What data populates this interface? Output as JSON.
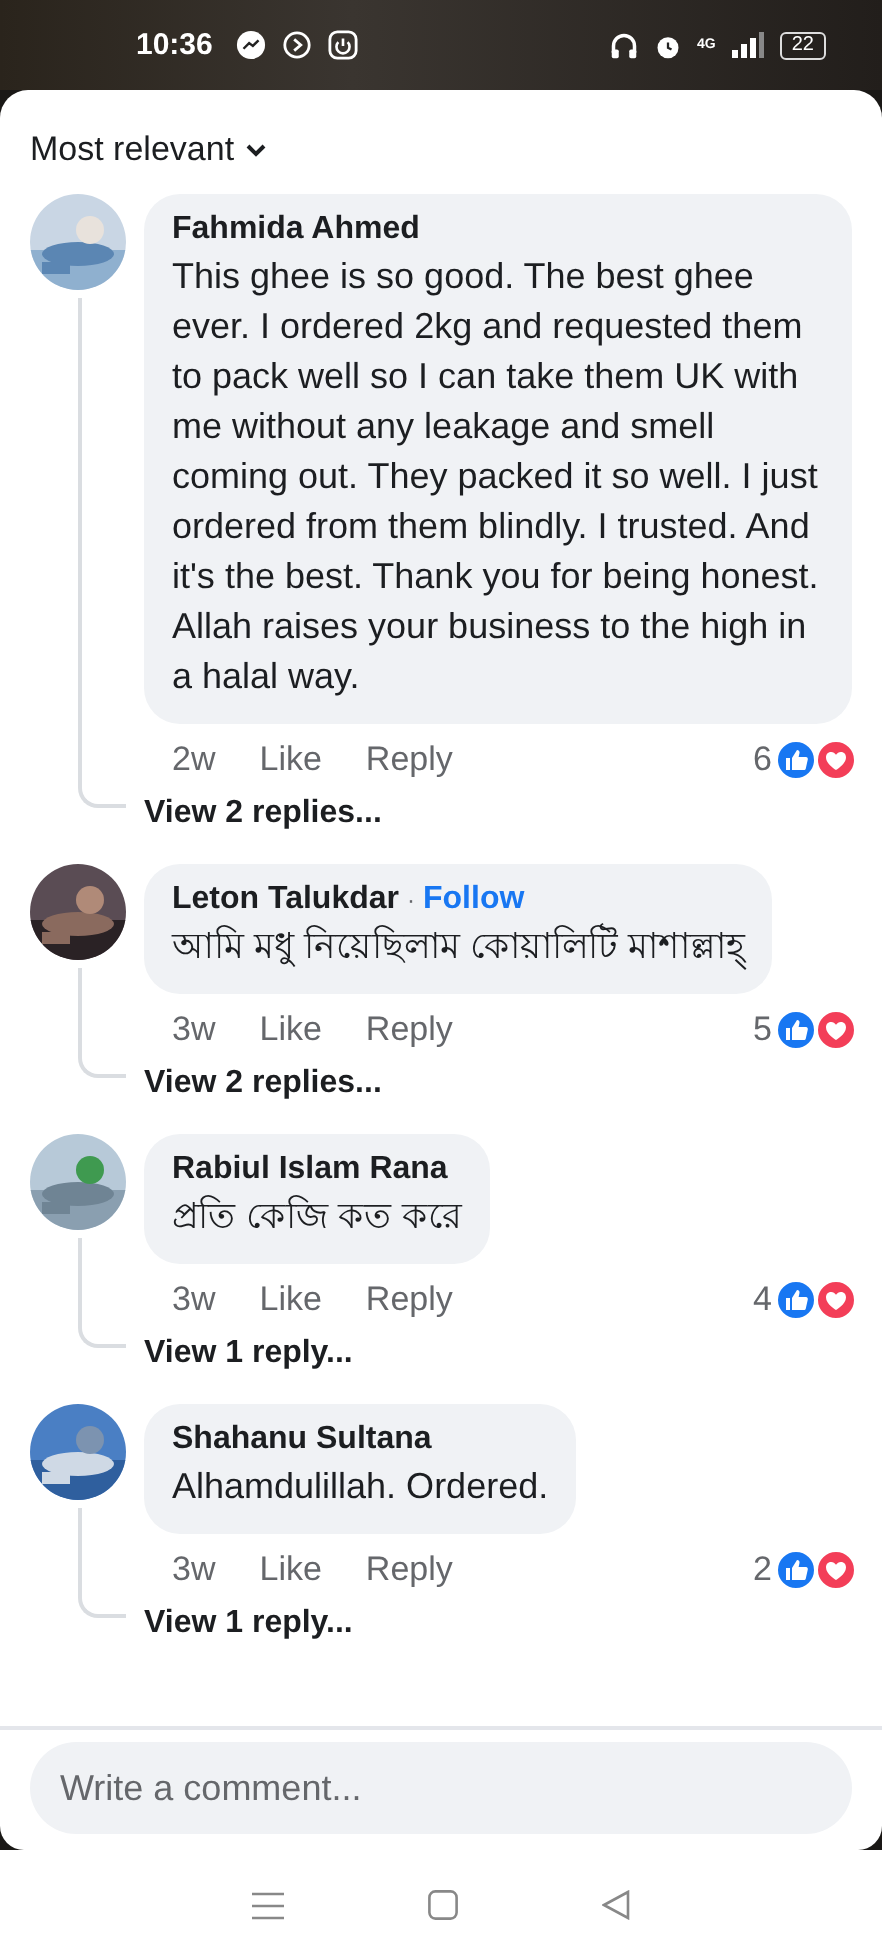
{
  "status_bar": {
    "time": "10:36",
    "network": "4G",
    "battery": "22"
  },
  "sort": {
    "label": "Most relevant"
  },
  "comments": [
    {
      "author": "Fahmida Ahmed",
      "text": "This ghee is so good. The best ghee ever. I ordered 2kg and requested them to pack well so I can take them UK with me without any leakage and smell coming out. They packed it so well. I just ordered from them blindly. I trusted. And it's the best. Thank you for being honest. Allah raises your business to the high in a halal way.",
      "age": "2w",
      "like": "Like",
      "reply": "Reply",
      "reaction_count": "6",
      "replies_link": "View 2 replies..."
    },
    {
      "author": "Leton Talukdar",
      "separator": "·",
      "follow": "Follow",
      "text": "আমি মধু নিয়েছিলাম কোয়ালিটি মাশাল্লাহ্",
      "age": "3w",
      "like": "Like",
      "reply": "Reply",
      "reaction_count": "5",
      "replies_link": "View 2 replies..."
    },
    {
      "author": "Rabiul Islam Rana",
      "text": "প্রতি কেজি কত করে",
      "age": "3w",
      "like": "Like",
      "reply": "Reply",
      "reaction_count": "4",
      "replies_link": "View 1 reply..."
    },
    {
      "author": "Shahanu Sultana",
      "text": "Alhamdulillah. Ordered.",
      "age": "3w",
      "like": "Like",
      "reply": "Reply",
      "reaction_count": "2",
      "replies_link": "View 1 reply..."
    }
  ],
  "composer": {
    "placeholder": "Write a comment..."
  }
}
